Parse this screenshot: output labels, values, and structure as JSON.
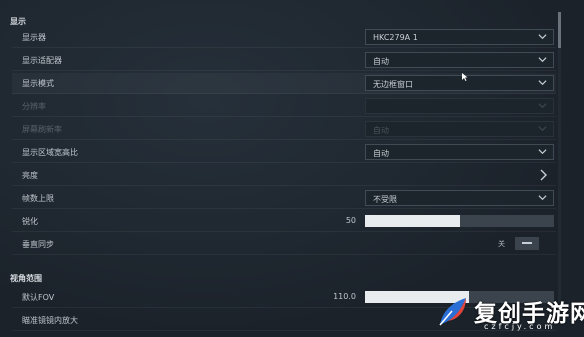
{
  "sections": {
    "display": "显示",
    "view": "视角范围"
  },
  "rows": {
    "monitor": {
      "label": "显示器",
      "value": "HKC279A 1"
    },
    "adapter": {
      "label": "显示适配器",
      "value": "自动"
    },
    "display_mode": {
      "label": "显示模式",
      "value": "无边框窗口"
    },
    "resolution": {
      "label": "分辨率",
      "value": ""
    },
    "refresh_rate": {
      "label": "屏幕刷新率",
      "value": "自动"
    },
    "aspect_ratio": {
      "label": "显示区域宽高比",
      "value": "自动"
    },
    "brightness": {
      "label": "亮度"
    },
    "fps_limit": {
      "label": "帧数上限",
      "value": "不受限"
    },
    "sharpen": {
      "label": "锐化",
      "value": "50",
      "level": 0.5
    },
    "vsync": {
      "label": "垂直同步",
      "state": "关"
    },
    "fov": {
      "label": "默认FOV",
      "value": "110.0",
      "level": 0.55
    },
    "ads_zoom": {
      "label": "瞄准镜镜内放大"
    }
  },
  "watermark": {
    "name": "复创手游网",
    "url": "czfcjy.com"
  },
  "icons": {
    "dropdown": "chevron-down-icon",
    "next": "chevron-right-icon",
    "cursor": "mouse-cursor-icon",
    "logo": "feather-logo-icon"
  },
  "colors": {
    "background": "#1c242c",
    "fill": "#e9ecef",
    "track": "#3b444d",
    "logo_blue": "#2b6fd6",
    "logo_red": "#e0443a"
  }
}
